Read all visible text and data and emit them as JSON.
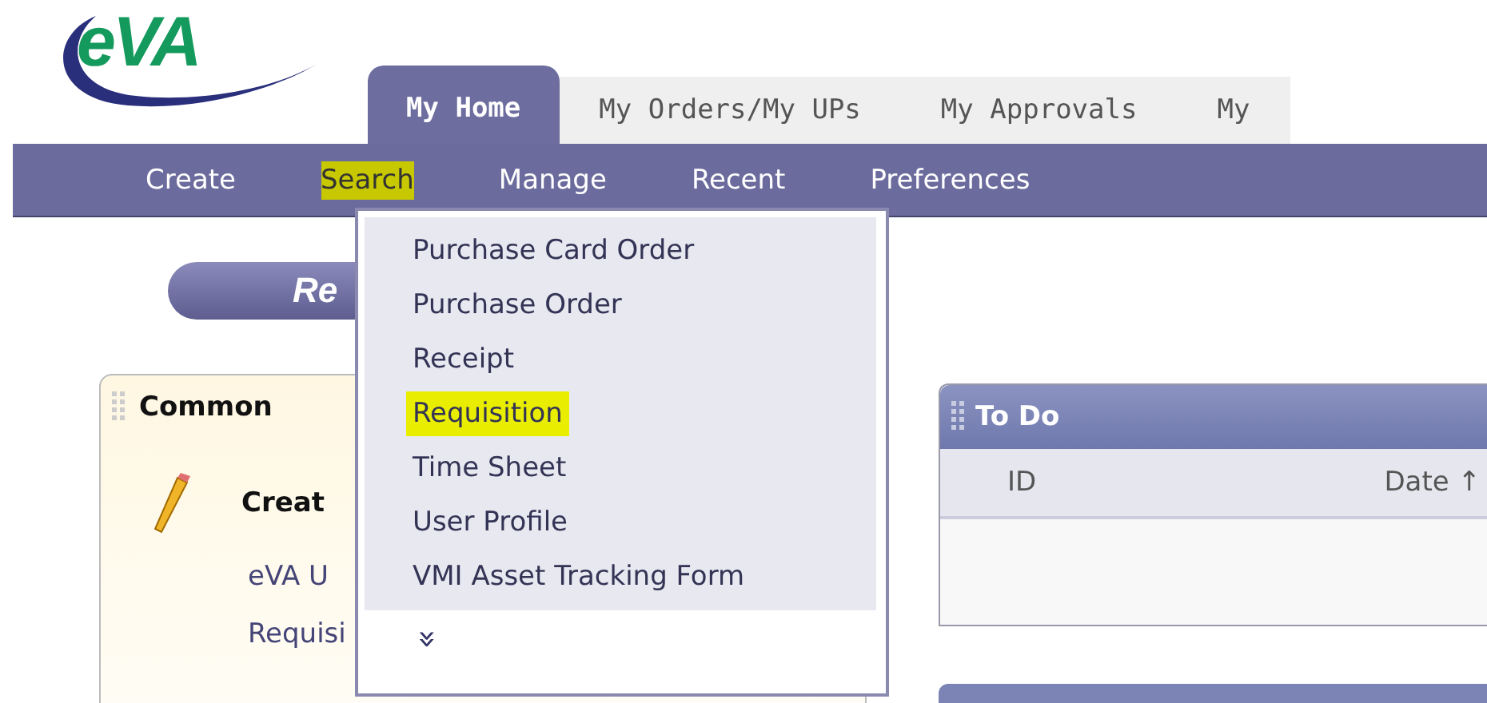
{
  "logo": "eVA",
  "tabs": [
    {
      "label": "My Home",
      "selected": true
    },
    {
      "label": "My Orders/My UPs",
      "selected": false
    },
    {
      "label": "My Approvals",
      "selected": false
    },
    {
      "label": "My",
      "selected": false
    }
  ],
  "nav": [
    {
      "label": "Create",
      "highlighted": false
    },
    {
      "label": "Search",
      "highlighted": true
    },
    {
      "label": "Manage",
      "highlighted": false
    },
    {
      "label": "Recent",
      "highlighted": false
    },
    {
      "label": "Preferences",
      "highlighted": false
    }
  ],
  "dropdown": {
    "items": [
      {
        "label": "Purchase Card Order",
        "highlighted": false
      },
      {
        "label": "Purchase Order",
        "highlighted": false
      },
      {
        "label": "Receipt",
        "highlighted": false
      },
      {
        "label": "Requisition",
        "highlighted": true
      },
      {
        "label": "Time Sheet",
        "highlighted": false
      },
      {
        "label": "User Profile",
        "highlighted": false
      },
      {
        "label": "VMI Asset Tracking Form",
        "highlighted": false
      }
    ],
    "more": "»"
  },
  "pill_button": "Re",
  "common_panel": {
    "title": "Common",
    "heading": "Creat",
    "links": [
      "eVA U",
      "Requisi"
    ]
  },
  "todo_panel": {
    "title": "To Do",
    "columns": [
      "ID",
      "Date ↑"
    ]
  }
}
